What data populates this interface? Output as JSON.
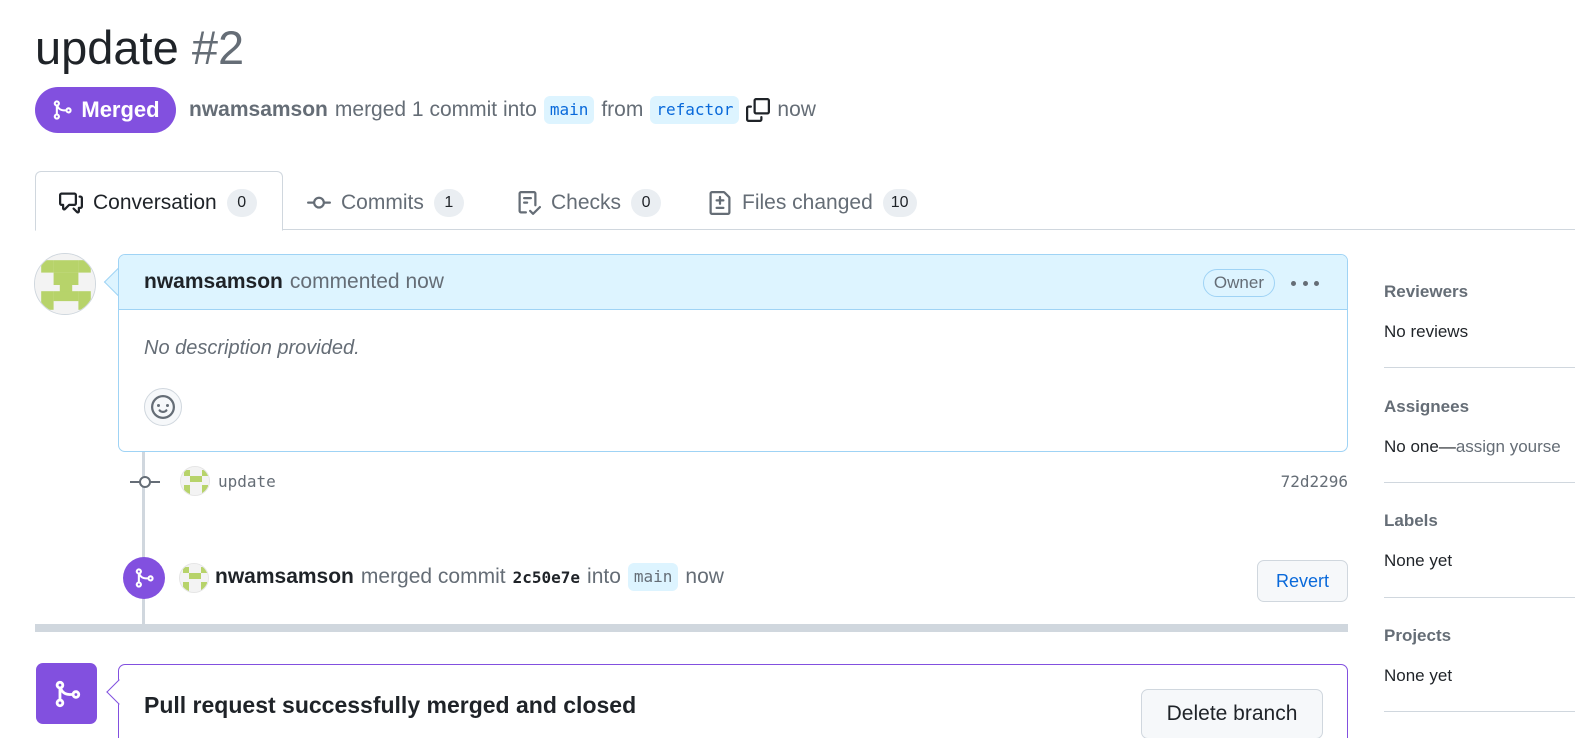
{
  "header": {
    "title": "update",
    "number": "#2",
    "state": "Merged",
    "author": "nwamsamson",
    "merge_text": "merged 1 commit into",
    "base_branch": "main",
    "from_text": "from",
    "head_branch": "refactor",
    "time": "now"
  },
  "tabs": [
    {
      "label": "Conversation",
      "count": "0",
      "icon": "comment-discussion-icon"
    },
    {
      "label": "Commits",
      "count": "1",
      "icon": "git-commit-icon"
    },
    {
      "label": "Checks",
      "count": "0",
      "icon": "checklist-icon"
    },
    {
      "label": "Files changed",
      "count": "10",
      "icon": "file-diff-icon"
    }
  ],
  "comment": {
    "author": "nwamsamson",
    "action": "commented now",
    "badge": "Owner",
    "body": "No description provided."
  },
  "commit": {
    "message": "update",
    "sha": "72d2296"
  },
  "merge_event": {
    "author": "nwamsamson",
    "text": "merged commit",
    "sha": "2c50e7e",
    "into": "into",
    "branch": "main",
    "time": "now",
    "revert_label": "Revert"
  },
  "merge_box": {
    "title": "Pull request successfully merged and closed",
    "delete_label": "Delete branch"
  },
  "sidebar": {
    "reviewers": {
      "label": "Reviewers",
      "value": "No reviews"
    },
    "assignees": {
      "label": "Assignees",
      "value": "No one—",
      "link": "assign yourse"
    },
    "labels": {
      "label": "Labels",
      "value": "None yet"
    },
    "projects": {
      "label": "Projects",
      "value": "None yet"
    }
  },
  "colors": {
    "merged_purple": "#8250df",
    "link_blue": "#0969da",
    "comment_header_bg": "#ddf4ff",
    "muted_text": "#656d76",
    "avatar_green": "#b7d36a"
  }
}
